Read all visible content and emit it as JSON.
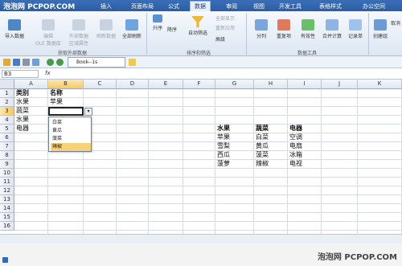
{
  "watermark": {
    "top_left": "泡泡网 PCPOP.COM",
    "bottom_right": "泡泡网 PCPOP.COM"
  },
  "menu": {
    "tabs": [
      "页面布局",
      "公式",
      "数据",
      "审阅",
      "视图",
      "开发工具",
      "表格样式",
      "办公空间"
    ],
    "first_tab": "插入",
    "active_tab": "数据"
  },
  "ribbon": {
    "import_data": "导入数据",
    "odbc_edit": "编辑\nOLE 数据库",
    "external_prop": "外部数据\n区域属性",
    "refresh": "刷新数据",
    "refresh_all": "全部刷新",
    "sort_asc": "升序",
    "sort_desc": "降序",
    "autofilter": "自动筛选",
    "show_all": "全部显示",
    "reapply": "重新应用",
    "advanced": "高级",
    "subtotal": "分列",
    "duplicates": "重复项",
    "validity": "有效性",
    "consolidate": "合并计算",
    "record": "记录单",
    "create_group": "创建组",
    "cancel": "取消",
    "group_external": "获取外部数据",
    "group_sortfilter": "排序和筛选",
    "group_datatools": "数据工具"
  },
  "doc_tab": "Book--1s",
  "formula": {
    "name_box": "B3",
    "fx": "fx"
  },
  "columns": [
    "A",
    "B",
    "C",
    "D",
    "E",
    "F",
    "G",
    "H",
    "I",
    "J",
    "K"
  ],
  "rows": [
    "1",
    "2",
    "3",
    "4",
    "5",
    "6",
    "7",
    "8",
    "9",
    "10",
    "11",
    "12",
    "13",
    "14",
    "15",
    "16"
  ],
  "cells": {
    "A1": "类别",
    "B1": "名称",
    "A2": "水果",
    "B2": "苹果",
    "A3": "蔬菜",
    "A4": "水果",
    "A5": "电器",
    "G5": "水果",
    "H5": "蔬菜",
    "I5": "电器",
    "G6": "苹果",
    "H6": "白菜",
    "I6": "空调",
    "G7": "雪梨",
    "H7": "黄瓜",
    "I7": "电扇",
    "G8": "西瓜",
    "H8": "菠菜",
    "I8": "冰箱",
    "G9": "菠萝",
    "H9": "辣椒",
    "I9": "电视"
  },
  "dropdown": {
    "options": [
      "白菜",
      "黄瓜",
      "菠菜",
      "辣椒"
    ],
    "highlighted_index": 3
  }
}
